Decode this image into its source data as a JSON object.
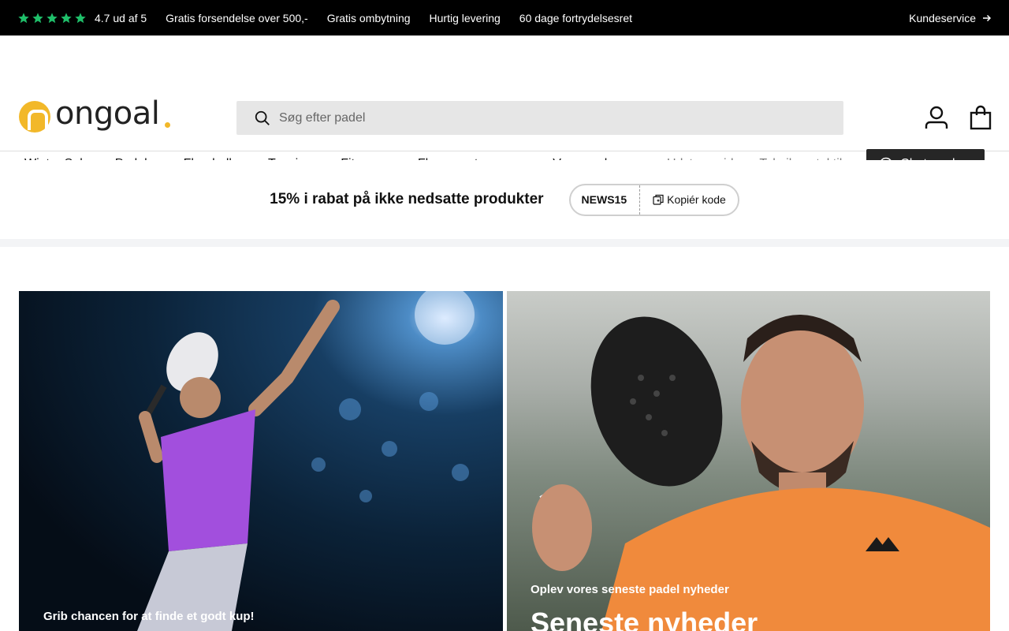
{
  "topbar": {
    "rating": "4.7 ud af 5",
    "stars_count": 5,
    "star_color": "#1fbf6a",
    "items": [
      "Gratis forsendelse over 500,-",
      "Gratis ombytning",
      "Hurtig levering",
      "60 dage fortrydelsesret"
    ],
    "service_label": "Kundeservice"
  },
  "header": {
    "logo_text": "ongoal",
    "brand_color": "#f2b829",
    "search_placeholder": "Søg efter padel"
  },
  "nav": {
    "items": [
      {
        "label": "Winter Sales",
        "has_dropdown": false
      },
      {
        "label": "Padel",
        "has_dropdown": true
      },
      {
        "label": "Floorball",
        "has_dropdown": true
      },
      {
        "label": "Tennis",
        "has_dropdown": true
      },
      {
        "label": "Fitness",
        "has_dropdown": true
      },
      {
        "label": "Flere sportsgrene",
        "has_dropdown": true
      },
      {
        "label": "Varemærker",
        "has_dropdown": false
      }
    ],
    "secondary": [
      "Udstyrsguide",
      "Teknik og taktik"
    ],
    "chat_label": "Chat med os"
  },
  "promo": {
    "text": "15% i rabat på ikke nedsatte produkter",
    "code": "NEWS15",
    "copy_label": "Kopiér kode"
  },
  "hero": {
    "left": {
      "caption": "Grib chancen for at finde et godt kup!"
    },
    "right": {
      "caption": "Oplev vores seneste padel nyheder",
      "title": "Seneste nyheder"
    }
  }
}
